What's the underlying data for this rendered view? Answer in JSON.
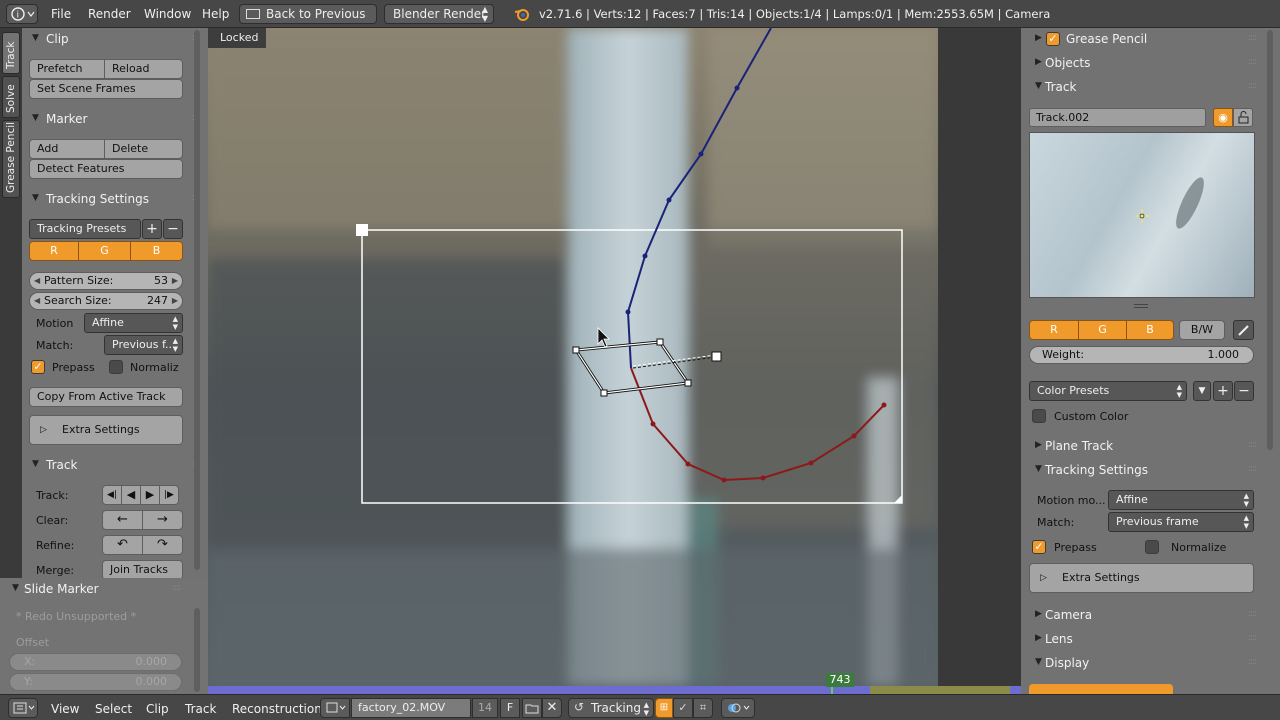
{
  "topbar": {
    "menus": [
      "File",
      "Render",
      "Window",
      "Help"
    ],
    "back_button": "Back to Previous",
    "engine": "Blender Render",
    "info": "v2.71.6 | Verts:12 | Faces:7 | Tris:14 | Objects:1/4 | Lamps:0/1 | Mem:2553.65M | Camera"
  },
  "tabs": [
    "Track",
    "Solve",
    "Grease Pencil"
  ],
  "left": {
    "clip": {
      "title": "Clip",
      "prefetch": "Prefetch",
      "reload": "Reload",
      "set_scene_frames": "Set Scene Frames"
    },
    "marker": {
      "title": "Marker",
      "add": "Add",
      "delete": "Delete",
      "detect": "Detect Features"
    },
    "tracking_settings": {
      "title": "Tracking Settings",
      "presets": "Tracking Presets",
      "r": "R",
      "g": "G",
      "b": "B",
      "pattern_label": "Pattern Size:",
      "pattern_value": "53",
      "search_label": "Search Size:",
      "search_value": "247",
      "motion_label": "Motion",
      "motion_value": "Affine",
      "match_label": "Match:",
      "match_value": "Previous f...",
      "prepass": "Prepass",
      "normalize": "Normaliz",
      "copy": "Copy From Active Track",
      "extra": "Extra Settings"
    },
    "track": {
      "title": "Track",
      "track_label": "Track:",
      "clear_label": "Clear:",
      "refine_label": "Refine:",
      "merge_label": "Merge:",
      "join": "Join Tracks"
    }
  },
  "slide": {
    "title": "Slide Marker",
    "redo": "* Redo Unsupported *",
    "offset": "Offset",
    "x_label": "X:",
    "x_value": "0.000",
    "y_label": "Y:",
    "y_value": "0.000"
  },
  "viewport": {
    "locked": "Locked",
    "frame": "743"
  },
  "right": {
    "grease_pencil": "Grease Pencil",
    "objects": "Objects",
    "track": "Track",
    "track_name": "Track.002",
    "r": "R",
    "g": "G",
    "b": "B",
    "bw": "B/W",
    "weight_label": "Weight:",
    "weight_value": "1.000",
    "color_presets": "Color Presets",
    "custom_color": "Custom Color",
    "plane_track": "Plane Track",
    "tracking_settings": "Tracking Settings",
    "motion_label": "Motion mo...",
    "motion_value": "Affine",
    "match_label": "Match:",
    "match_value": "Previous frame",
    "prepass": "Prepass",
    "normalize": "Normalize",
    "extra": "Extra Settings",
    "camera": "Camera",
    "lens": "Lens",
    "display": "Display"
  },
  "bottombar": {
    "menus": [
      "View",
      "Select",
      "Clip",
      "Track",
      "Reconstruction"
    ],
    "clip_name": "factory_02.MOV",
    "users": "14",
    "fake": "F",
    "mode": "Tracking"
  }
}
